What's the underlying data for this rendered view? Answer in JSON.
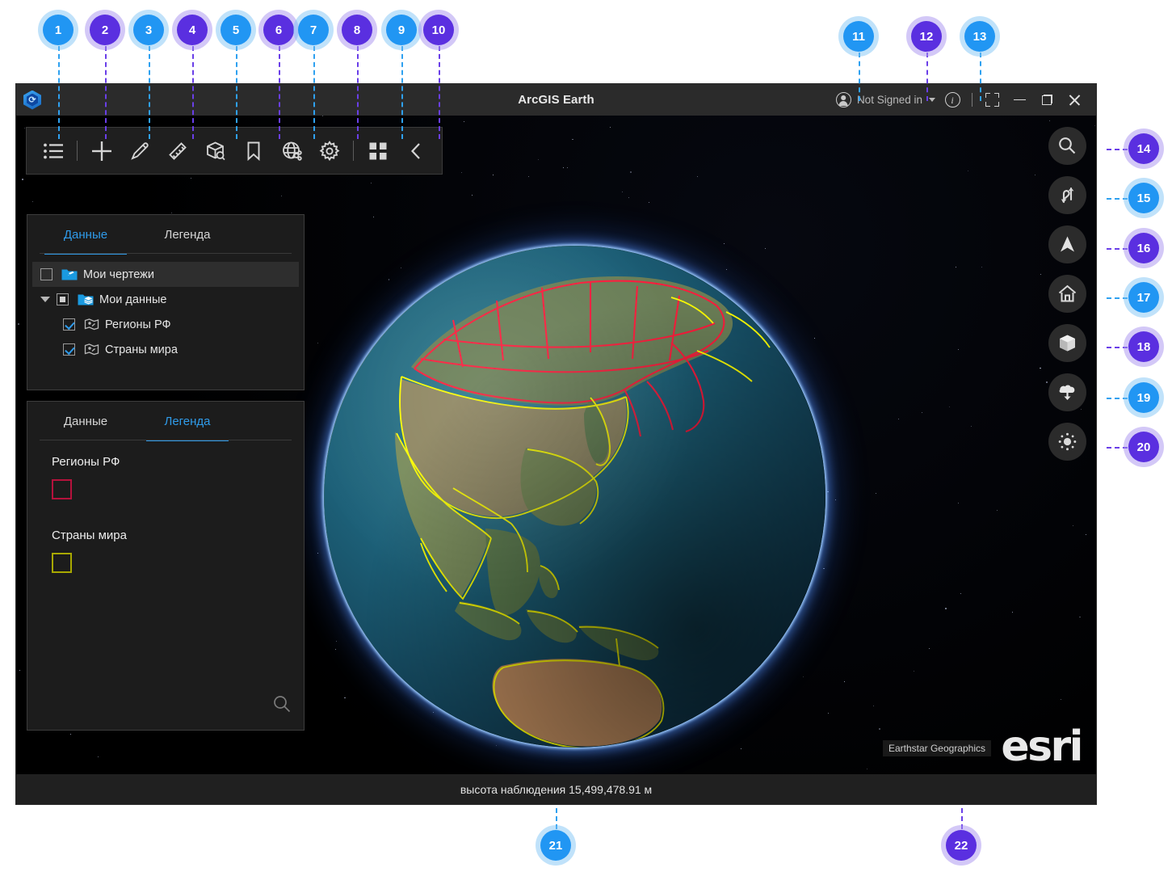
{
  "window": {
    "title": "ArcGIS Earth",
    "logo_icon": "arcgis-earth-hex-logo",
    "account": {
      "label": "Not Signed in",
      "avatar_icon": "user-avatar-icon",
      "caret_icon": "chevron-down-icon"
    },
    "controls": {
      "info": "info-icon",
      "fullscreen": "fullscreen-icon",
      "minimize": "minimize-icon",
      "maximize": "maximize-restore-icon",
      "close": "close-icon"
    }
  },
  "toolbar": {
    "items": [
      {
        "name": "table-of-contents",
        "icon": "list-icon"
      },
      {
        "name": "add-data",
        "icon": "plus-icon"
      },
      {
        "name": "draw",
        "icon": "pencil-icon"
      },
      {
        "name": "measure",
        "icon": "ruler-icon"
      },
      {
        "name": "explore-3d",
        "icon": "box-search-icon"
      },
      {
        "name": "bookmarks",
        "icon": "bookmark-icon"
      },
      {
        "name": "basemap-share",
        "icon": "globe-share-icon"
      },
      {
        "name": "settings",
        "icon": "gear-icon"
      },
      {
        "name": "apps",
        "icon": "grid-4-icon"
      },
      {
        "name": "collapse",
        "icon": "chevron-left-icon"
      }
    ]
  },
  "data_panel": {
    "tabs": [
      {
        "label": "Данные",
        "active": true
      },
      {
        "label": "Легенда",
        "active": false
      }
    ],
    "tree": [
      {
        "label": "Мои чертежи",
        "check": "unchecked",
        "icon": "folder-drawings-icon",
        "selected": true,
        "indent": 0
      },
      {
        "label": "Мои данные",
        "check": "partial",
        "icon": "folder-data-icon",
        "expanded": true,
        "indent": 0
      },
      {
        "label": "Регионы РФ",
        "check": "checked",
        "icon": "layer-icon",
        "indent": 1
      },
      {
        "label": "Страны мира",
        "check": "checked",
        "icon": "layer-icon",
        "indent": 1
      }
    ]
  },
  "legend_panel": {
    "tabs": [
      {
        "label": "Данные",
        "active": false
      },
      {
        "label": "Легенда",
        "active": true
      }
    ],
    "entries": [
      {
        "label": "Регионы РФ",
        "swatch_color": "#b5123c"
      },
      {
        "label": "Страны мира",
        "swatch_color": "#a8a800"
      }
    ],
    "search_icon": "search-icon"
  },
  "right_tools": [
    {
      "name": "search",
      "icon": "search-icon"
    },
    {
      "name": "navigation-swap",
      "icon": "swap-arrows-icon"
    },
    {
      "name": "compass-north",
      "icon": "north-arrow-icon"
    },
    {
      "name": "home-view",
      "icon": "home-icon"
    },
    {
      "name": "3d-mode",
      "icon": "cube-icon"
    },
    {
      "name": "offline-download",
      "icon": "cloud-download-icon"
    },
    {
      "name": "display-brightness",
      "icon": "sun-icon"
    }
  ],
  "map": {
    "attribution": "Earthstar Geographics",
    "brand": "esri",
    "layers": [
      {
        "name": "Регионы РФ",
        "boundary_color": "#ff1a3c"
      },
      {
        "name": "Страны мира",
        "boundary_color": "#ffff00"
      }
    ]
  },
  "statusbar": {
    "text": "высота наблюдения 15,499,478.91 м"
  },
  "callouts": [
    {
      "n": "1",
      "color": "blue"
    },
    {
      "n": "2",
      "color": "purple"
    },
    {
      "n": "3",
      "color": "blue"
    },
    {
      "n": "4",
      "color": "purple"
    },
    {
      "n": "5",
      "color": "blue"
    },
    {
      "n": "6",
      "color": "purple"
    },
    {
      "n": "7",
      "color": "blue"
    },
    {
      "n": "8",
      "color": "purple"
    },
    {
      "n": "9",
      "color": "blue"
    },
    {
      "n": "10",
      "color": "purple"
    },
    {
      "n": "11",
      "color": "blue"
    },
    {
      "n": "12",
      "color": "purple"
    },
    {
      "n": "13",
      "color": "blue"
    },
    {
      "n": "14",
      "color": "purple"
    },
    {
      "n": "15",
      "color": "blue"
    },
    {
      "n": "16",
      "color": "purple"
    },
    {
      "n": "17",
      "color": "blue"
    },
    {
      "n": "18",
      "color": "purple"
    },
    {
      "n": "19",
      "color": "blue"
    },
    {
      "n": "20",
      "color": "purple"
    },
    {
      "n": "21",
      "color": "blue"
    },
    {
      "n": "22",
      "color": "purple"
    }
  ],
  "colors": {
    "accent_blue": "#2f9bea",
    "badge_blue": "#2196f3",
    "badge_purple": "#5a2fe0",
    "panel_bg": "#1c1c1c",
    "titlebar_bg": "#2b2b2b"
  }
}
